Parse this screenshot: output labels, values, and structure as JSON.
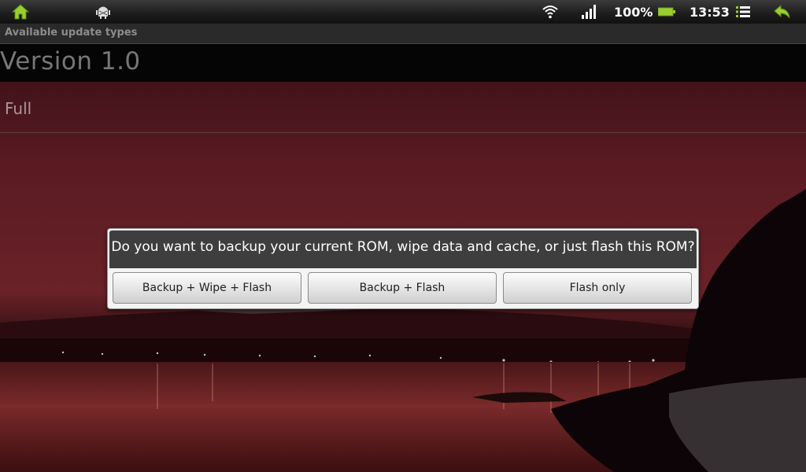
{
  "status_bar": {
    "icons": {
      "home": "home-icon",
      "android": "android-debug-icon",
      "wifi": "wifi-icon",
      "signal": "signal-icon",
      "battery": "battery-icon",
      "menu": "menu-icon",
      "back": "back-icon"
    },
    "battery_level": "100%",
    "time": "13:53"
  },
  "app": {
    "title": "Available update types",
    "version": "Version 1.0",
    "list_item": "Full"
  },
  "dialog": {
    "message": "Do you want to backup your current ROM, wipe data and cache, or just flash this ROM?",
    "buttons": {
      "backup_wipe_flash": "Backup + Wipe + Flash",
      "backup_flash": "Backup + Flash",
      "flash_only": "Flash only"
    }
  },
  "colors": {
    "accent_green": "#9acd32",
    "dialog_header": "#3e3e3e",
    "dialog_body": "#f4f4f4"
  }
}
